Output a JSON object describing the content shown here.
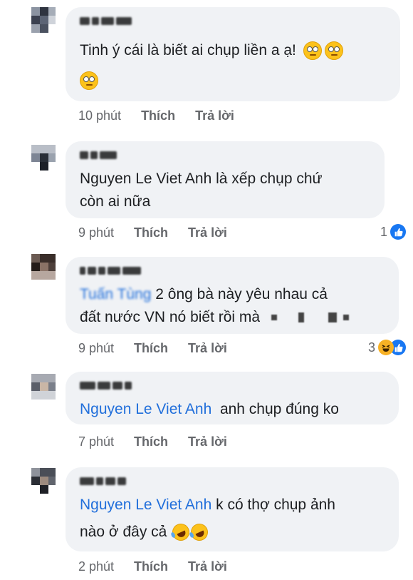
{
  "comments": [
    {
      "text_lines": [
        "Tinh ý cái là biết ai chụp liền a ạ!",
        ""
      ],
      "emojis": [
        "face-with-rolling-eyes",
        "face-with-rolling-eyes",
        "face-with-rolling-eyes"
      ],
      "time": "10 phút",
      "like": "Thích",
      "reply": "Trả lời"
    },
    {
      "text_lines": [
        "Nguyen Le Viet Anh là xếp  chụp chứ",
        "còn ai nữa"
      ],
      "time": "9 phút",
      "like": "Thích",
      "reply": "Trả lời",
      "reaction_count": "1",
      "reaction_icons": [
        "like-icon"
      ]
    },
    {
      "mention": "Tuấn Tùng",
      "text_lines": [
        "2 ông bà này yêu nhau cả",
        "đất nước VN nó biết rồi mà"
      ],
      "time": "9 phút",
      "like": "Thích",
      "reply": "Trả lời",
      "reaction_count": "3",
      "reaction_icons": [
        "haha-icon",
        "like-icon"
      ]
    },
    {
      "mention": "Nguyen Le Viet Anh",
      "text_lines": [
        "anh chụp đúng ko"
      ],
      "time": "7 phút",
      "like": "Thích",
      "reply": "Trả lời"
    },
    {
      "mention": "Nguyen Le Viet Anh",
      "text_lines": [
        "k có thợ chụp ảnh",
        "nào ở đây cả"
      ],
      "emojis": [
        "rolling-on-floor-laughing",
        "rolling-on-floor-laughing"
      ],
      "time": "2 phút",
      "like": "Thích",
      "reply": "Trả lời"
    }
  ],
  "colors": {
    "bubble": "#f0f2f5",
    "mention": "#216fdb",
    "meta": "#65676b",
    "like": "#1877f2",
    "haha": "#f7b125"
  }
}
